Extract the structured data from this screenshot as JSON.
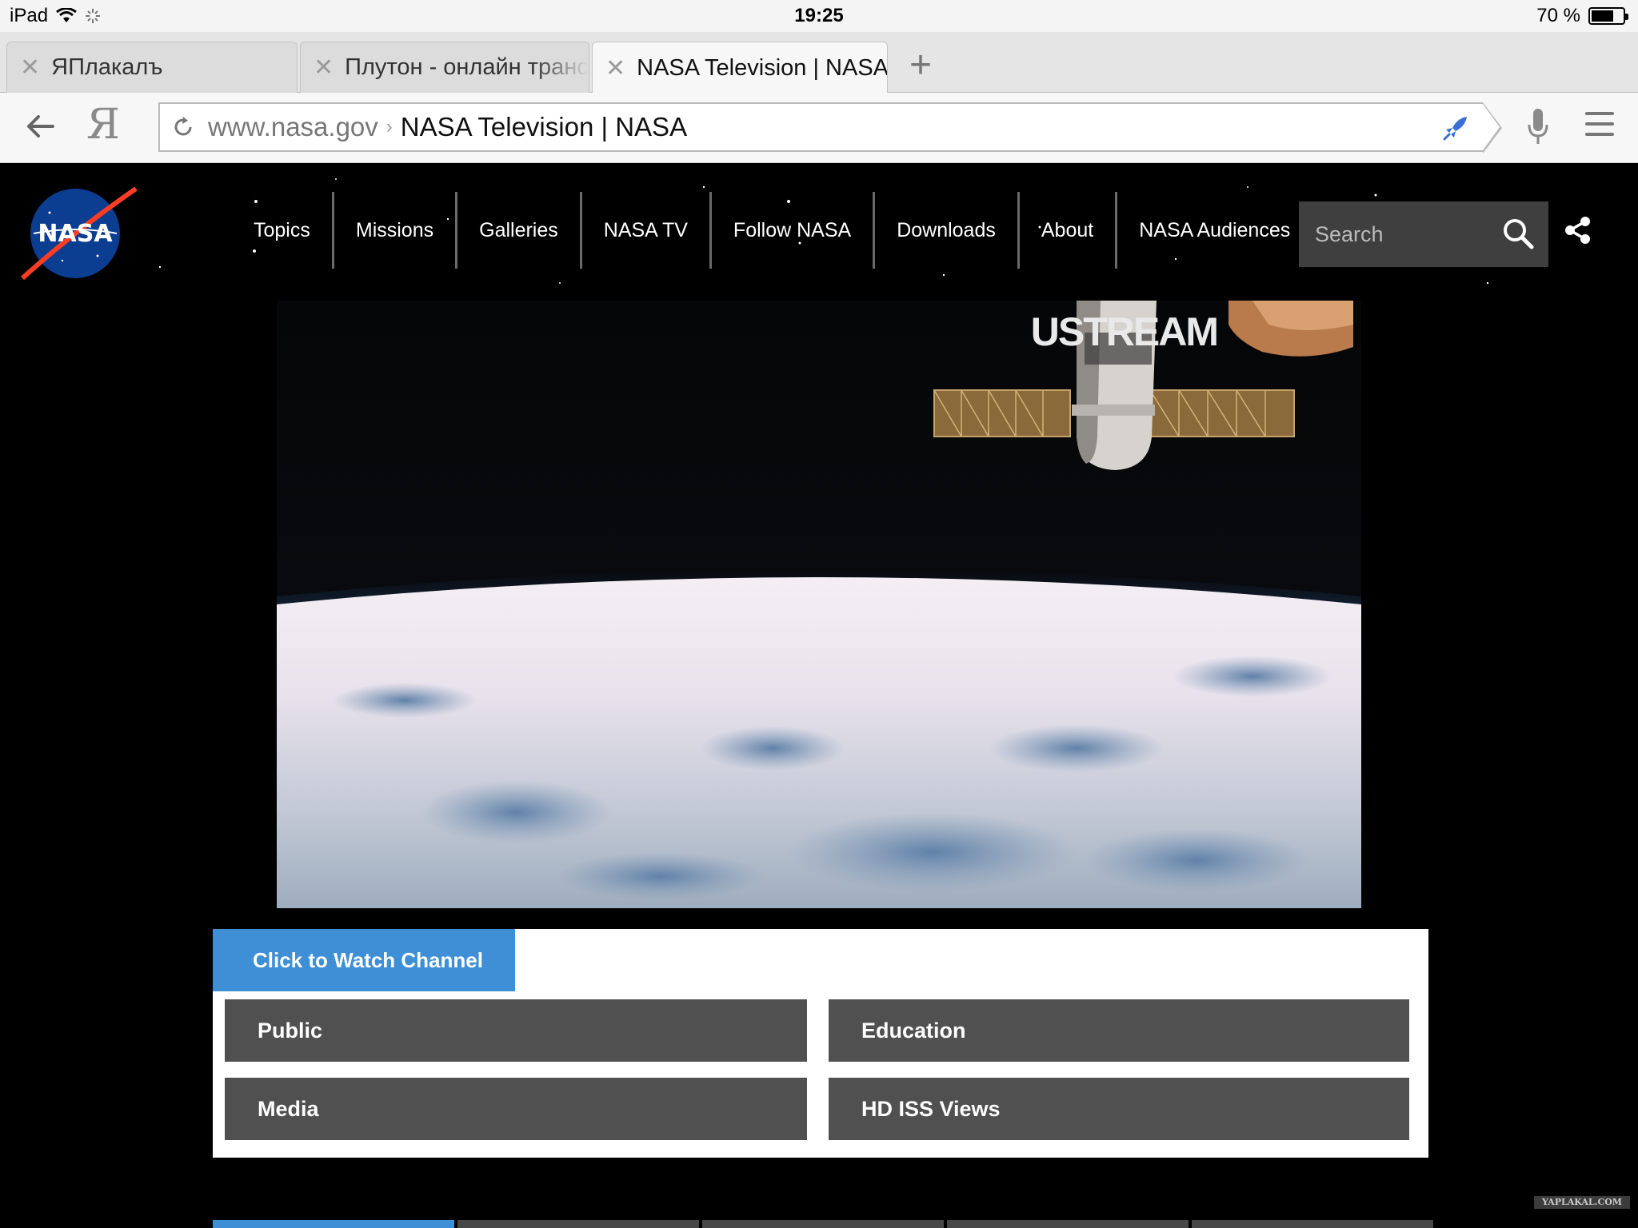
{
  "status_bar": {
    "device": "iPad",
    "time": "19:25",
    "battery_text": "70 %",
    "battery_level": 0.7
  },
  "tabs": [
    {
      "title": "ЯПлакалъ"
    },
    {
      "title": "Плутон - онлайн транс"
    },
    {
      "title": "NASA Television | NASA"
    }
  ],
  "address_bar": {
    "domain": "www.nasa.gov",
    "separator": "›",
    "page_title": "NASA Television | NASA"
  },
  "nasa": {
    "logo_text": "NASA",
    "nav_items": [
      "Topics",
      "Missions",
      "Galleries",
      "NASA TV",
      "Follow NASA",
      "Downloads",
      "About",
      "NASA Audiences"
    ],
    "search_placeholder": "Search",
    "video_overlay": "USTREAM",
    "watch_label": "Click to Watch Channel",
    "channels": [
      "Public",
      "Education",
      "Media",
      "HD ISS Views"
    ]
  },
  "watermark": "YAPLAKAL.COM",
  "colors": {
    "accent_blue": "#3e8fd6",
    "channel_button": "#505050",
    "nasa_blue": "#0b3d91",
    "nasa_red": "#fc3d21"
  }
}
